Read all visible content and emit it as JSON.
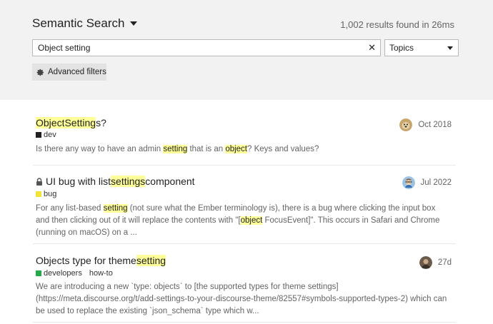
{
  "header": {
    "title": "Semantic Search",
    "results_count": "1,002 results found in 26ms"
  },
  "search": {
    "value": "Object setting",
    "clear_glyph": "✕",
    "type_select": "Topics",
    "advanced_filters_label": "Advanced filters"
  },
  "colors": {
    "header_bg": "#f2f2f2",
    "highlight": "#ffff99",
    "category_dev": "#231f20",
    "category_bug": "#f1e33c",
    "category_developers": "#25aa4a"
  },
  "results": [
    {
      "title_parts": [
        "",
        "Object",
        " ",
        "Setting",
        "s?"
      ],
      "locked": false,
      "category": "dev",
      "tags": [],
      "excerpt_parts": [
        "Is there any way to have an admin ",
        "setting",
        " that is an ",
        "object",
        "? Keys and values?"
      ],
      "date": "Oct 2018",
      "avatar_icon": "dog-avatar-icon"
    },
    {
      "title_parts": [
        "UI bug with list ",
        "settings",
        " component"
      ],
      "locked": true,
      "category": "bug",
      "tags": [],
      "excerpt_parts": [
        "For any list-based ",
        "setting",
        " (not sure what the Ember terminology is), there is a bug where clicking the input box and then clicking out of it will replace the contents with \"[",
        "object",
        " FocusEvent]\". This occurs in Safari and Chrome (running on macOS) on a ..."
      ],
      "date": "Jul 2022",
      "avatar_icon": "cartoon-avatar-icon"
    },
    {
      "title_parts": [
        "Objects type for theme ",
        "setting",
        ""
      ],
      "locked": false,
      "category": "developers",
      "tags": [
        "how-to"
      ],
      "excerpt_parts": [
        "We are introducing a new `type: objects` to [the supported types for theme settings](https://meta.discourse.org/t/add-settings-to-your-discourse-theme/82557#symbols-supported-types-2) which can be used to replace the existing `json_schema` type which w..."
      ],
      "date": "27d",
      "avatar_icon": "photo-avatar-icon"
    }
  ]
}
